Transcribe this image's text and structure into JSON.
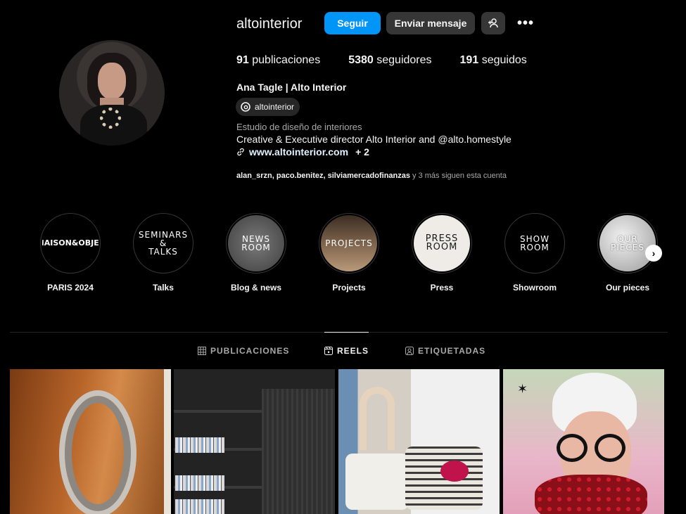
{
  "profile": {
    "username": "altointerior",
    "follow_label": "Seguir",
    "message_label": "Enviar mensaje",
    "more_label": "•••",
    "stats": {
      "posts_count": "91",
      "posts_label": "publicaciones",
      "followers_count": "5380",
      "followers_label": "seguidores",
      "following_count": "191",
      "following_label": "seguidos"
    },
    "display_name": "Ana Tagle | Alto Interior",
    "threads_handle": "altointerior",
    "category": "Estudio de diseño de interiores",
    "bio": "Creative & Executive director Alto Interior and @alto.homestyle",
    "link": "www.altointerior.com",
    "link_extra": "+ 2",
    "followed_by_names": "alan_srzn, paco.benitez, silviamercadofinanzas",
    "followed_by_suffix": " y 3 más siguen esta cuenta"
  },
  "highlights": [
    {
      "label": "PARIS 2024",
      "cover_text": "MAISON&OBJET",
      "bg": "#000000",
      "fg": "#ffffff"
    },
    {
      "label": "Talks",
      "cover_text": "SEMINARS\n&\nTALKS",
      "bg": "#000000",
      "fg": "#ffffff"
    },
    {
      "label": "Blog & news",
      "cover_text": "NEWS\nROOM",
      "bg": "#5a5a5a",
      "fg": "#ffffff"
    },
    {
      "label": "Projects",
      "cover_text": "PROJECTS",
      "bg": "#6b5a4a",
      "fg": "#ffffff"
    },
    {
      "label": "Press",
      "cover_text": "PRESS\nROOM",
      "bg": "#efece8",
      "fg": "#1a1a1a"
    },
    {
      "label": "Showroom",
      "cover_text": "SHOW\nROOM",
      "bg": "#000000",
      "fg": "#ffffff"
    },
    {
      "label": "Our pieces",
      "cover_text": "OUR\nPIECES",
      "bg": "#d8d8d8",
      "fg": "#ffffff"
    }
  ],
  "tabs": [
    {
      "label": "PUBLICACIONES",
      "icon": "grid-icon",
      "active": false
    },
    {
      "label": "REELS",
      "icon": "reels-icon",
      "active": true
    },
    {
      "label": "ETIQUETADAS",
      "icon": "tagged-icon",
      "active": false
    }
  ],
  "colors": {
    "accent": "#0095f6",
    "background": "#000000",
    "secondary_button": "#363636"
  }
}
